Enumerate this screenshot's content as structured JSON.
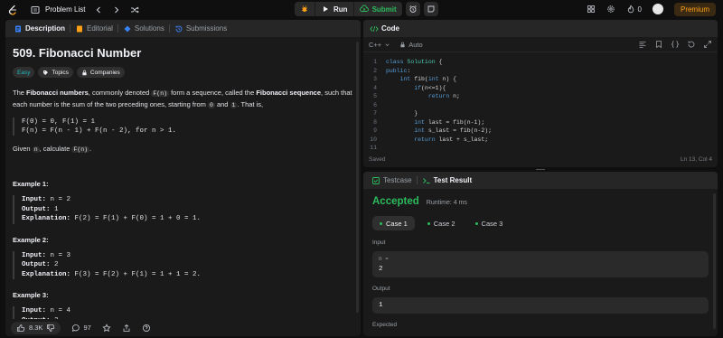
{
  "nav": {
    "problem_list": "Problem List",
    "run": "Run",
    "submit": "Submit",
    "streak_count": "0",
    "premium": "Premium"
  },
  "left_tabs": [
    {
      "label": "Description",
      "icon": "description-icon"
    },
    {
      "label": "Editorial",
      "icon": "editorial-icon"
    },
    {
      "label": "Solutions",
      "icon": "solutions-icon"
    },
    {
      "label": "Submissions",
      "icon": "submissions-icon"
    }
  ],
  "problem": {
    "title": "509. Fibonacci Number",
    "difficulty": "Easy",
    "topics": "Topics",
    "companies": "Companies",
    "intro_1": "The ",
    "intro_bold_1": "Fibonacci numbers",
    "intro_2": ", commonly denoted ",
    "intro_code": "F(n)",
    "intro_3": " form a sequence, called the ",
    "intro_bold_2": "Fibonacci sequence",
    "intro_4": ", such that each number is the sum of the two preceding ones, starting from ",
    "intro_code_0": "0",
    "intro_5": " and ",
    "intro_code_1": "1",
    "intro_6": ". That is,",
    "formula_1": "F(0) = 0, F(1) = 1",
    "formula_2": "F(n) = F(n - 1) + F(n - 2), for n > 1.",
    "given_1": "Given ",
    "given_code_n": "n",
    "given_2": ", calculate ",
    "given_code_fn": "F(n)",
    "given_3": "."
  },
  "examples": [
    {
      "title": "Example 1:",
      "input": "n = 2",
      "output": "1",
      "explanation": "F(2) = F(1) + F(0) = 1 + 0 = 1."
    },
    {
      "title": "Example 2:",
      "input": "n = 3",
      "output": "2",
      "explanation": "F(3) = F(2) + F(1) = 1 + 1 = 2."
    },
    {
      "title": "Example 3:",
      "input": "n = 4",
      "output": "3"
    }
  ],
  "example_labels": {
    "input": "Input:",
    "output": "Output:",
    "explanation": "Explanation:"
  },
  "left_footer": {
    "likes": "8.3K",
    "comments": "97"
  },
  "code_panel": {
    "title": "Code",
    "language": "C++",
    "auto": "Auto",
    "status_left": "Saved",
    "status_right": "Ln 13, Col 4",
    "lines": [
      {
        "n": "1",
        "html": "<span class=\"kw\">class</span> <span class=\"ty\">Solution</span> {"
      },
      {
        "n": "2",
        "html": "<span class=\"kw\">public</span>:"
      },
      {
        "n": "3",
        "html": "    <span class=\"kw\">int</span> fib(<span class=\"kw\">int</span> n) {"
      },
      {
        "n": "4",
        "html": "        <span class=\"kw\">if</span>(n&lt;=1){"
      },
      {
        "n": "5",
        "html": "            <span class=\"kw\">return</span> n;"
      },
      {
        "n": "6",
        "html": ""
      },
      {
        "n": "7",
        "html": "        }"
      },
      {
        "n": "8",
        "html": "        <span class=\"kw\">int</span> last = fib(n-1);"
      },
      {
        "n": "9",
        "html": "        <span class=\"kw\">int</span> s_last = fib(n-2);"
      },
      {
        "n": "10",
        "html": "        <span class=\"kw\">return</span> last + s_last;"
      },
      {
        "n": "11",
        "html": ""
      }
    ]
  },
  "result": {
    "tab_testcase": "Testcase",
    "tab_result": "Test Result",
    "verdict": "Accepted",
    "runtime": "Runtime: 4 ms",
    "cases": [
      "Case 1",
      "Case 2",
      "Case 3"
    ],
    "input_label": "Input",
    "input_var": "n =",
    "input_val": "2",
    "output_label": "Output",
    "output_val": "1",
    "expected_label": "Expected"
  },
  "colors": {
    "accent_green": "#2cbb5d",
    "easy": "#1cbaba",
    "premium": "#ffa116"
  }
}
